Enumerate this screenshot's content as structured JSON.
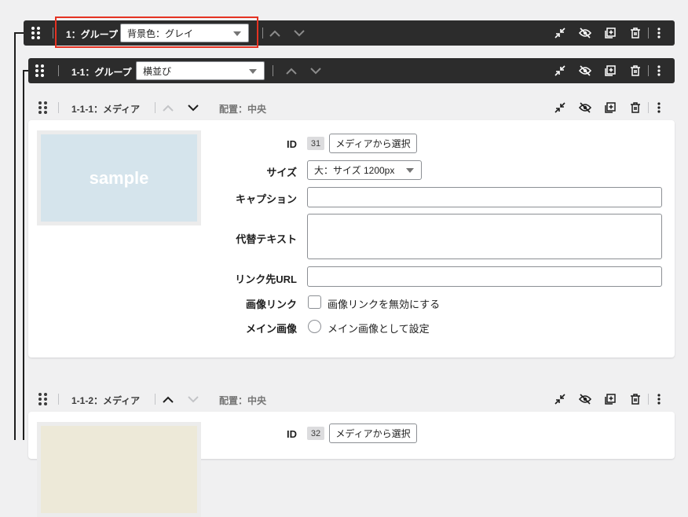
{
  "group1": {
    "title": "1：グループ",
    "select_value": "背景色：グレイ"
  },
  "group11": {
    "title": "1-1：グループ",
    "select_value": "横並び"
  },
  "media1": {
    "title": "1-1-1：メディア",
    "placement": "配置：中央",
    "thumb_text": "sample",
    "thumb_color": "#d5e4ec",
    "id_label": "ID",
    "id_value": "31",
    "select_media_button": "メディアから選択",
    "size_label": "サイズ",
    "size_value": "大：サイズ 1200px",
    "caption_label": "キャプション",
    "alt_label": "代替テキスト",
    "link_label": "リンク先URL",
    "image_link_label": "画像リンク",
    "image_link_option": "画像リンクを無効にする",
    "main_image_label": "メイン画像",
    "main_image_option": "メイン画像として設定"
  },
  "media2": {
    "title": "1-1-2：メディア",
    "placement": "配置：中央",
    "thumb_color": "#ede9d8",
    "id_label": "ID",
    "id_value": "32",
    "select_media_button": "メディアから選択"
  },
  "colors": {
    "bar": "#2c2c2c",
    "highlight": "#e53222",
    "background": "#f0f0f1"
  },
  "icons": [
    "drag-handle-icon",
    "chevron-up-icon",
    "chevron-down-icon",
    "collapse-icon",
    "eye-slash-icon",
    "duplicate-icon",
    "trash-icon",
    "more-vertical-icon"
  ]
}
